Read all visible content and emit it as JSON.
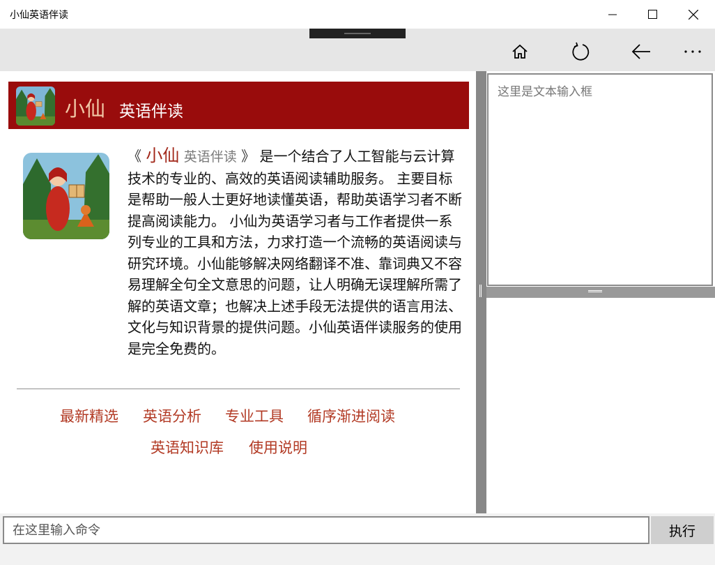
{
  "window": {
    "title": "小仙英语伴读"
  },
  "toolbar": {
    "home": "home-icon",
    "refresh": "refresh-icon",
    "back": "back-arrow-icon",
    "more": "more-icon"
  },
  "banner": {
    "name": "小仙",
    "subtitle": "英语伴读"
  },
  "description": {
    "open_quote": "《",
    "name": "小仙",
    "subtitle": "英语伴读",
    "close_quote": "》",
    "text": "是一个结合了人工智能与云计算技术的专业的、高效的英语阅读辅助服务。 主要目标是帮助一般人士更好地读懂英语，帮助英语学习者不断提高阅读能力。 小仙为英语学习者与工作者提供一系列专业的工具和方法，力求打造一个流畅的英语阅读与研究环境。小仙能够解决网络翻译不准、靠词典又不容易理解全句全文意思的问题，让人明确无误理解所需了解的英语文章；也解决上述手段无法提供的语言用法、文化与知识背景的提供问题。小仙英语伴读服务的使用是完全免费的。"
  },
  "nav": {
    "links": [
      "最新精选",
      "英语分析",
      "专业工具",
      "循序渐进阅读",
      "英语知识库",
      "使用说明"
    ]
  },
  "right": {
    "input_placeholder": "这里是文本输入框"
  },
  "command": {
    "placeholder": "在这里输入命令",
    "execute_label": "执行"
  },
  "colors": {
    "banner": "#990c0c",
    "accent": "#b23a24",
    "name": "#f1c7a6"
  }
}
